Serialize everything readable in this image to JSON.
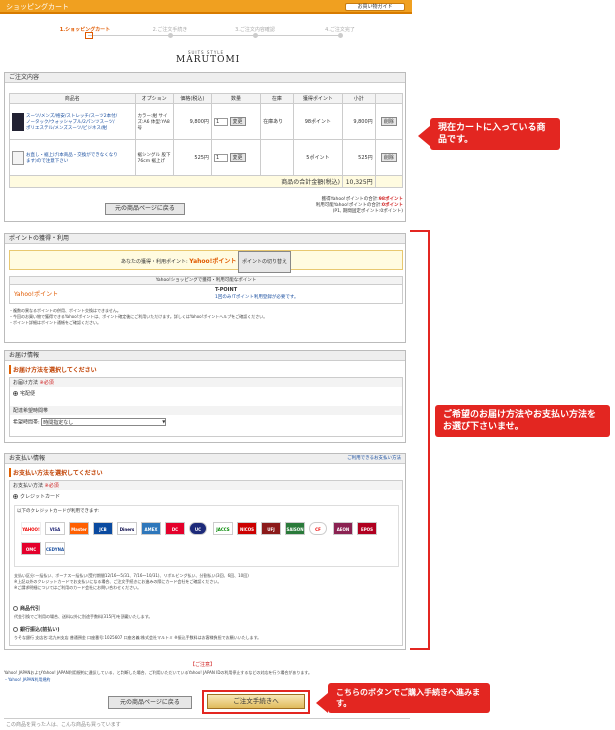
{
  "header": {
    "title": "ショッピングカート",
    "guide_label": "お買い物ガイド"
  },
  "steps": [
    "1.ショッピングカート",
    "2.ご注文手続き",
    "3.ご注文内容確認",
    "4.ご注文完了"
  ],
  "logo": {
    "small": "SUITS STYLE",
    "big": "MARUTOMI"
  },
  "order": {
    "title": "ご注文内容",
    "columns": [
      "商品名",
      "オプション",
      "価格(税込)",
      "数量",
      "在庫",
      "獲得ポイント",
      "小計",
      ""
    ],
    "items": [
      {
        "name": "スーツ/メンズ/格安/ストレッチ/スーツ2本付/ノータック/ウォッシャブル/2パンツスーツ/ポリエステル/メンズスーツ/ビジネス/紺",
        "option": "カラー:紺 サイズ:A6 体型:YA8号",
        "price": "9,800円",
        "qty": "1",
        "qty_btn": "変更",
        "stock": "在庫あり",
        "points": "98ポイント",
        "subtotal": "9,800円",
        "del": "削除"
      },
      {
        "name": "お直し・裾上げ(本商品・交換ができなくなります)ので注意下さい",
        "option": "裾シングル 股下76cm 裾上げ",
        "price": "525円",
        "qty": "1",
        "qty_btn": "変更",
        "stock": "",
        "points": "5ポイント",
        "subtotal": "525円",
        "del": "削除"
      }
    ],
    "total_label": "商品の合計金額(税込)",
    "total": "10,325円",
    "back_label": "元の商品ページに戻る",
    "points_note1": "獲得Yahoo!ポイントの合計:",
    "points_val1": "98ポイント",
    "points_note2": "利用可能Yahoo!ポイントの合計:",
    "points_val2": "0ポイント",
    "points_note3": "(P1, 期間固定ポイント:0ポイント)"
  },
  "callouts": {
    "cart": "現在カートに入っている商品です。",
    "method": "ご希望のお届け方法やお支払い方法をお選び下さいませ。",
    "proceed": "こちらのボタンでご購入手続きへ進みます。"
  },
  "points": {
    "title": "ポイントの獲得・利用",
    "your_points": "あなたの獲得・利用ポイント:",
    "yahoo_label": "Yahoo!ポイント",
    "switch_btn": "ポイントの切り替え",
    "table_head": "Yahoo!ショッピングで獲得・利用可能なポイント",
    "yahoo": "Yahoo!ポイント",
    "tpoint": "T-POINT",
    "tpoint_note": "1回のみ!Tポイント利用登録が必要です。",
    "notes": [
      "・複数の異なるポイントの併用、ポイント交換はできません。",
      "・今回のお買い物で獲得できるYahoo!ポイントは、ポイント確定後にご利用いただけます。詳しくはYahoo!ポイントヘルプをご確認ください。",
      "・ポイント詳細はポイント通帳をご確認ください。"
    ]
  },
  "delivery": {
    "title": "お届け情報",
    "instruction": "お届け方法を選択してください",
    "method_label": "お届け方法",
    "required": "※必須",
    "option": "宅配便",
    "date_label": "配達希望時間帯",
    "time_label": "希望時間帯:",
    "time_value": "時間指定なし"
  },
  "payment": {
    "title": "お支払い情報",
    "link": "ご利用できるお支払い方法",
    "instruction": "お支払い方法を選択してください",
    "method_label": "お支払い方法",
    "required": "※必須",
    "credit": "クレジットカード",
    "cards_note": "以下のクレジットカードが利用できます:",
    "cards": [
      "YAHOO!",
      "VISA",
      "Master",
      "JCB",
      "Diners",
      "AMEX",
      "DC",
      "UC",
      "JACCS",
      "NICOS",
      "UFJ",
      "SAISON",
      "CF",
      "AEON",
      "EPOS",
      "OMC",
      "CEDYNA"
    ],
    "notes": [
      "支払い区分:一括払い、ボーナス一括払い(受付期間12/16〜5/31、7/16〜10/31)、リボルビング払い、分割払い(3回、6回、10回)",
      "※上記以外のクレジットカードでお支払いになる場合、ご注文手続きにお進みの際にカード会社をご確認ください。",
      "※ご請求明細についてはご利用のカード会社にお問い合わせください。"
    ],
    "cod": "商品代引",
    "cod_note": "代金引換でご利用の場合、送料以外に別途手数料(315円)を頂戴いたします。",
    "bank": "銀行振込(前払い)",
    "bank_note": "りそな銀行 支店名:北九州支店 普通預金 口座番号:1025607 口座名義:株式会社マルトミ ※振込手数料はお客様負担でお願いいたします。"
  },
  "notice": {
    "label": "【ご注意】",
    "text": "Yahoo! JAPANおよびYahoo! JAPAN利用規約に違反している、と判断した場合、ご利用いただいているYahoo! JAPAN IDの利用停止するなどの対応を行う場合があります。",
    "link": "・Yahoo! JAPAN利用規約"
  },
  "footer": {
    "back_label": "元の商品ページに戻る",
    "proceed_label": "ご注文手続きへ",
    "bought_also": "この商品を買った人は、こんな商品も買っています"
  }
}
